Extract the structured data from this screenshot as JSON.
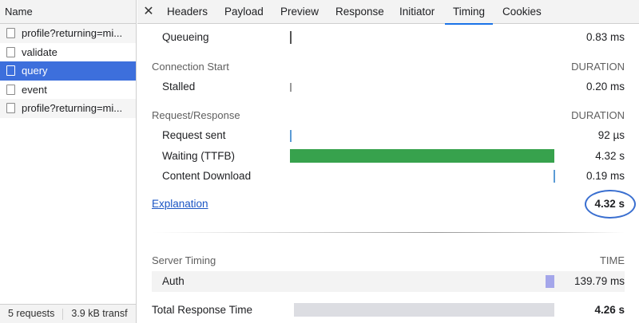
{
  "request_list": {
    "header": "Name",
    "items": [
      {
        "label": "profile?returning=mi..."
      },
      {
        "label": "validate"
      },
      {
        "label": "query"
      },
      {
        "label": "event"
      },
      {
        "label": "profile?returning=mi..."
      }
    ],
    "footer": {
      "requests": "5 requests",
      "transferred": "3.9 kB transf"
    }
  },
  "tabs": [
    "Headers",
    "Payload",
    "Preview",
    "Response",
    "Initiator",
    "Timing",
    "Cookies"
  ],
  "active_tab": "Timing",
  "timing": {
    "queueing": {
      "label": "Queueing",
      "value": "0.83 ms"
    },
    "connection_section": {
      "title": "Connection Start",
      "right": "DURATION"
    },
    "stalled": {
      "label": "Stalled",
      "value": "0.20 ms"
    },
    "request_section": {
      "title": "Request/Response",
      "right": "DURATION"
    },
    "request_sent": {
      "label": "Request sent",
      "value": "92 µs"
    },
    "waiting": {
      "label": "Waiting (TTFB)",
      "value": "4.32 s"
    },
    "content_download": {
      "label": "Content Download",
      "value": "0.19 ms"
    },
    "explanation": "Explanation",
    "total": "4.32 s",
    "server_section": {
      "title": "Server Timing",
      "right": "TIME"
    },
    "auth": {
      "label": "Auth",
      "value": "139.79 ms"
    },
    "total_response": {
      "label": "Total Response Time",
      "value": "4.26 s"
    }
  },
  "colors": {
    "selected_row": "#3d6fdc",
    "waiting_bar": "#37a24d",
    "tick": "#5b9bd5",
    "auth_bar": "#a4a6ea",
    "total_bar": "#dcdde2",
    "highlight_circle": "#3a6fd0"
  }
}
